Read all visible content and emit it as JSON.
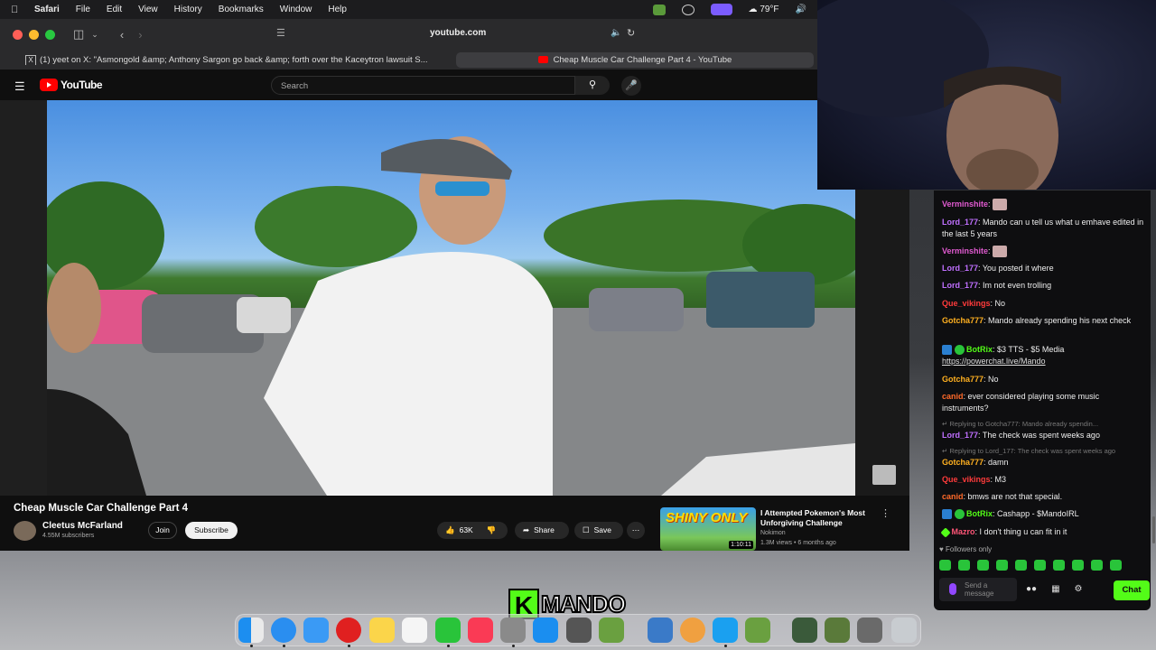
{
  "menubar": {
    "app": "Safari",
    "items": [
      "File",
      "Edit",
      "View",
      "History",
      "Bookmarks",
      "Window",
      "Help"
    ],
    "weather": "79°F"
  },
  "browser": {
    "url": "youtube.com",
    "tabs": [
      {
        "label": "(1) yeet on X: \"Asmongold &amp; Anthony Sargon go back &amp; forth over the Kaceytron lawsuit S..."
      },
      {
        "label": "Cheap Muscle Car Challenge Part 4 - YouTube"
      }
    ]
  },
  "youtube": {
    "logo": "YouTube",
    "search_placeholder": "Search",
    "video": {
      "title": "Cheap Muscle Car Challenge Part 4",
      "channel": "Cleetus McFarland",
      "subscribers": "4.55M subscribers",
      "join": "Join",
      "subscribe": "Subscribe",
      "likes": "63K",
      "share": "Share",
      "save": "Save"
    },
    "recommended": {
      "thumb_text": "SHINY ONLY",
      "duration": "1:10:11",
      "title": "I Attempted Pokemon's Most Unforgiving Challenge",
      "channel": "Nokimon",
      "meta": "1.3M views • 6 months ago"
    }
  },
  "chat": {
    "messages": [
      {
        "user": "Verminshite",
        "color": "#e05ad0",
        "text": "",
        "emote": true
      },
      {
        "user": "Lord_177",
        "color": "#c070ff",
        "text": "Mando can u tell us what u emhave edited in the last 5 years"
      },
      {
        "user": "Verminshite",
        "color": "#e05ad0",
        "text": "",
        "emote": true
      },
      {
        "user": "Lord_177",
        "color": "#c070ff",
        "text": "You posted it where"
      },
      {
        "user": "Lord_177",
        "color": "#c070ff",
        "text": "Im not even trolling"
      },
      {
        "user": "Que_vikings",
        "color": "#ff3b3b",
        "text": "No"
      },
      {
        "user": "Gotcha777",
        "color": "#ffb020",
        "text": "Mando already spending his next check"
      },
      {
        "user": "BotRix",
        "color": "#53fc18",
        "text": "$3 TTS - $5 Media",
        "link": "https://powerchat.live/Mando"
      },
      {
        "user": "Gotcha777",
        "color": "#ffb020",
        "text": "No"
      },
      {
        "user": "canid",
        "color": "#ff6a2a",
        "text": "ever considered playing some music instruments?"
      },
      {
        "reply": "Replying to Gotcha777: Mando already spendin...",
        "user": "Lord_177",
        "color": "#c070ff",
        "text": "The check was spent weeks ago"
      },
      {
        "reply": "Replying to Lord_177: The check was spent weeks ago",
        "user": "Gotcha777",
        "color": "#ffb020",
        "text": "damn"
      },
      {
        "user": "Que_vikings",
        "color": "#ff3b3b",
        "text": "M3"
      },
      {
        "user": "canid",
        "color": "#ff6a2a",
        "text": "bmws are not that special."
      },
      {
        "user": "BotRix",
        "color": "#53fc18",
        "text": "Cashapp - $MandoIRL"
      },
      {
        "user": "Mazro",
        "color": "#ff5577",
        "text": "I don't thing u can fit in it"
      }
    ],
    "followers_only": "Followers only",
    "send_placeholder": "Send a message",
    "chat_button": "Chat"
  },
  "overlay": {
    "streamer": "MANDO",
    "kick_letter": "K"
  }
}
